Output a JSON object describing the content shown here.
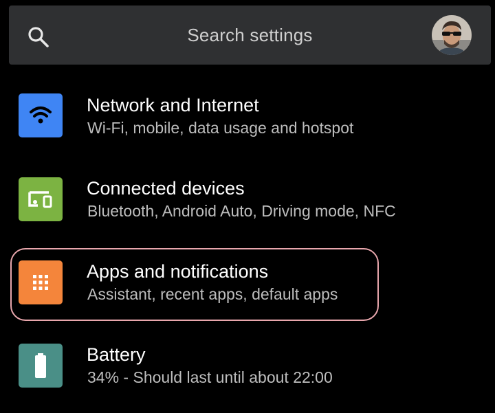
{
  "search": {
    "placeholder": "Search settings"
  },
  "settings": [
    {
      "title": "Network and Internet",
      "subtitle": "Wi-Fi, mobile, data usage and hotspot",
      "icon": "wifi-icon",
      "color": "#3f85f4"
    },
    {
      "title": "Connected devices",
      "subtitle": "Bluetooth, Android Auto, Driving mode, NFC",
      "icon": "devices-icon",
      "color": "#7cb342"
    },
    {
      "title": "Apps and notifications",
      "subtitle": "Assistant, recent apps, default apps",
      "icon": "apps-grid-icon",
      "color": "#f4853b",
      "highlighted": true
    },
    {
      "title": "Battery",
      "subtitle": "34% - Should last until about 22:00",
      "icon": "battery-icon",
      "color": "#4a8f87"
    }
  ],
  "colors": {
    "background": "#000000",
    "search_bar": "#2f3032",
    "highlight_outline": "#e9a7ad"
  }
}
